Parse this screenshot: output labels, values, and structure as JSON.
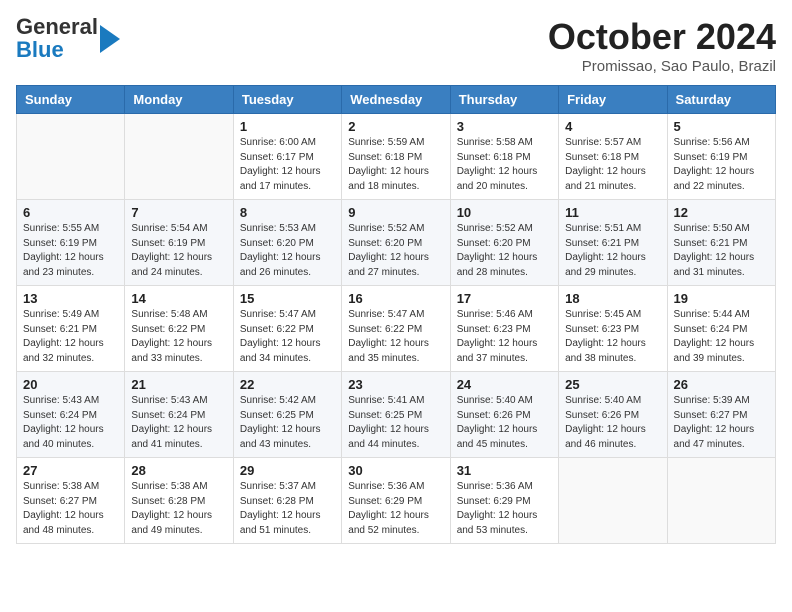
{
  "header": {
    "logo_general": "General",
    "logo_blue": "Blue",
    "month_year": "October 2024",
    "location": "Promissao, Sao Paulo, Brazil"
  },
  "weekdays": [
    "Sunday",
    "Monday",
    "Tuesday",
    "Wednesday",
    "Thursday",
    "Friday",
    "Saturday"
  ],
  "weeks": [
    [
      null,
      null,
      {
        "day": 1,
        "sunrise": "6:00 AM",
        "sunset": "6:17 PM",
        "daylight": "12 hours and 17 minutes."
      },
      {
        "day": 2,
        "sunrise": "5:59 AM",
        "sunset": "6:18 PM",
        "daylight": "12 hours and 18 minutes."
      },
      {
        "day": 3,
        "sunrise": "5:58 AM",
        "sunset": "6:18 PM",
        "daylight": "12 hours and 20 minutes."
      },
      {
        "day": 4,
        "sunrise": "5:57 AM",
        "sunset": "6:18 PM",
        "daylight": "12 hours and 21 minutes."
      },
      {
        "day": 5,
        "sunrise": "5:56 AM",
        "sunset": "6:19 PM",
        "daylight": "12 hours and 22 minutes."
      }
    ],
    [
      {
        "day": 6,
        "sunrise": "5:55 AM",
        "sunset": "6:19 PM",
        "daylight": "12 hours and 23 minutes."
      },
      {
        "day": 7,
        "sunrise": "5:54 AM",
        "sunset": "6:19 PM",
        "daylight": "12 hours and 24 minutes."
      },
      {
        "day": 8,
        "sunrise": "5:53 AM",
        "sunset": "6:20 PM",
        "daylight": "12 hours and 26 minutes."
      },
      {
        "day": 9,
        "sunrise": "5:52 AM",
        "sunset": "6:20 PM",
        "daylight": "12 hours and 27 minutes."
      },
      {
        "day": 10,
        "sunrise": "5:52 AM",
        "sunset": "6:20 PM",
        "daylight": "12 hours and 28 minutes."
      },
      {
        "day": 11,
        "sunrise": "5:51 AM",
        "sunset": "6:21 PM",
        "daylight": "12 hours and 29 minutes."
      },
      {
        "day": 12,
        "sunrise": "5:50 AM",
        "sunset": "6:21 PM",
        "daylight": "12 hours and 31 minutes."
      }
    ],
    [
      {
        "day": 13,
        "sunrise": "5:49 AM",
        "sunset": "6:21 PM",
        "daylight": "12 hours and 32 minutes."
      },
      {
        "day": 14,
        "sunrise": "5:48 AM",
        "sunset": "6:22 PM",
        "daylight": "12 hours and 33 minutes."
      },
      {
        "day": 15,
        "sunrise": "5:47 AM",
        "sunset": "6:22 PM",
        "daylight": "12 hours and 34 minutes."
      },
      {
        "day": 16,
        "sunrise": "5:47 AM",
        "sunset": "6:22 PM",
        "daylight": "12 hours and 35 minutes."
      },
      {
        "day": 17,
        "sunrise": "5:46 AM",
        "sunset": "6:23 PM",
        "daylight": "12 hours and 37 minutes."
      },
      {
        "day": 18,
        "sunrise": "5:45 AM",
        "sunset": "6:23 PM",
        "daylight": "12 hours and 38 minutes."
      },
      {
        "day": 19,
        "sunrise": "5:44 AM",
        "sunset": "6:24 PM",
        "daylight": "12 hours and 39 minutes."
      }
    ],
    [
      {
        "day": 20,
        "sunrise": "5:43 AM",
        "sunset": "6:24 PM",
        "daylight": "12 hours and 40 minutes."
      },
      {
        "day": 21,
        "sunrise": "5:43 AM",
        "sunset": "6:24 PM",
        "daylight": "12 hours and 41 minutes."
      },
      {
        "day": 22,
        "sunrise": "5:42 AM",
        "sunset": "6:25 PM",
        "daylight": "12 hours and 43 minutes."
      },
      {
        "day": 23,
        "sunrise": "5:41 AM",
        "sunset": "6:25 PM",
        "daylight": "12 hours and 44 minutes."
      },
      {
        "day": 24,
        "sunrise": "5:40 AM",
        "sunset": "6:26 PM",
        "daylight": "12 hours and 45 minutes."
      },
      {
        "day": 25,
        "sunrise": "5:40 AM",
        "sunset": "6:26 PM",
        "daylight": "12 hours and 46 minutes."
      },
      {
        "day": 26,
        "sunrise": "5:39 AM",
        "sunset": "6:27 PM",
        "daylight": "12 hours and 47 minutes."
      }
    ],
    [
      {
        "day": 27,
        "sunrise": "5:38 AM",
        "sunset": "6:27 PM",
        "daylight": "12 hours and 48 minutes."
      },
      {
        "day": 28,
        "sunrise": "5:38 AM",
        "sunset": "6:28 PM",
        "daylight": "12 hours and 49 minutes."
      },
      {
        "day": 29,
        "sunrise": "5:37 AM",
        "sunset": "6:28 PM",
        "daylight": "12 hours and 51 minutes."
      },
      {
        "day": 30,
        "sunrise": "5:36 AM",
        "sunset": "6:29 PM",
        "daylight": "12 hours and 52 minutes."
      },
      {
        "day": 31,
        "sunrise": "5:36 AM",
        "sunset": "6:29 PM",
        "daylight": "12 hours and 53 minutes."
      },
      null,
      null
    ]
  ]
}
